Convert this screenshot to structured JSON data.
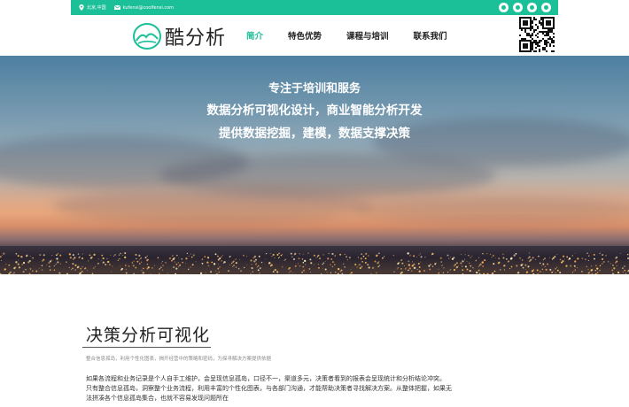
{
  "topbar": {
    "location": "北京,中国",
    "email": "kufensi@coolfensi.com",
    "social_icons": [
      "weibo-icon",
      "wechat-icon",
      "tencent-icon",
      "qq-icon"
    ],
    "accent_color": "#1bbf98"
  },
  "header": {
    "logo_text": "酷分析",
    "nav": [
      {
        "label": "简介",
        "active": true
      },
      {
        "label": "特色优势",
        "active": false
      },
      {
        "label": "课程与培训",
        "active": false
      },
      {
        "label": "联系我们",
        "active": false
      }
    ]
  },
  "hero": {
    "line1": "专注于培训和服务",
    "line2": "数据分析可视化设计，商业智能分析开发",
    "line3": "提供数据挖掘，建模，数据支撑决策"
  },
  "section": {
    "title": "决策分析可视化",
    "subtitle": "整合信息孤岛，利用个性化图表，揭开经营中的策略和密码，为探寻解决方案提供依据",
    "body": [
      "如果各流程和业务记录是个人自手工维护，会呈现信息孤岛，口径不一，渠道多元，决策者看到的报表会呈现统计和分析结论冲突。",
      "只有整合信息孤岛，洞察整个业务流程，利用丰富的个性化图表，与各部门沟通，才能帮助决策者寻找解决方案。从整体把握，如果无",
      "法拼凑各个信息孤岛集合，也就不容易发现问题所在"
    ]
  }
}
